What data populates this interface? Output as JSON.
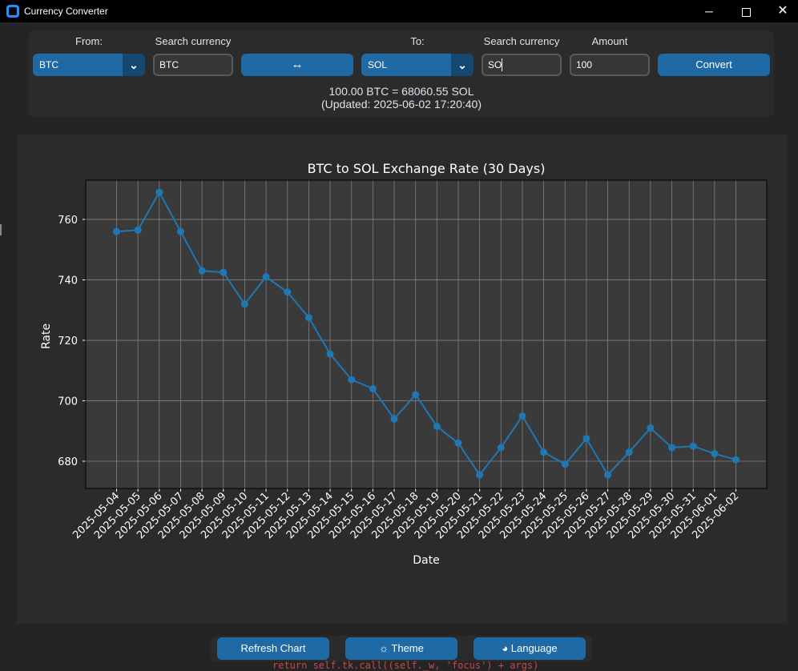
{
  "window": {
    "title": "Currency Converter",
    "minimize": "─",
    "close": "✕"
  },
  "converter": {
    "from_label": "From:",
    "from_value": "BTC",
    "from_search_label": "Search currency",
    "from_search_value": "BTC",
    "swap_label": "↔",
    "to_label": "To:",
    "to_value": "SOL",
    "to_search_label": "Search currency",
    "to_search_value": "SO",
    "amount_label": "Amount",
    "amount_value": "100",
    "convert_label": "Convert",
    "result_line": "100.00 BTC = 68060.55 SOL",
    "updated_line": "(Updated: 2025-06-02 17:20:40)",
    "dropdown_arrow": "⌄"
  },
  "chart_data": {
    "type": "line",
    "title": "BTC to SOL Exchange Rate (30 Days)",
    "xlabel": "Date",
    "ylabel": "Rate",
    "ylim": [
      671,
      773
    ],
    "yticks": [
      680,
      700,
      720,
      740,
      760
    ],
    "grid": true,
    "x": [
      "2025-05-04",
      "2025-05-05",
      "2025-05-06",
      "2025-05-07",
      "2025-05-08",
      "2025-05-09",
      "2025-05-10",
      "2025-05-11",
      "2025-05-12",
      "2025-05-13",
      "2025-05-14",
      "2025-05-15",
      "2025-05-16",
      "2025-05-17",
      "2025-05-18",
      "2025-05-19",
      "2025-05-20",
      "2025-05-21",
      "2025-05-22",
      "2025-05-23",
      "2025-05-24",
      "2025-05-25",
      "2025-05-26",
      "2025-05-27",
      "2025-05-28",
      "2025-05-29",
      "2025-05-30",
      "2025-05-31",
      "2025-06-01",
      "2025-06-02"
    ],
    "series": [
      {
        "values": [
          756.0,
          756.5,
          769.0,
          756.0,
          743.0,
          742.5,
          732.0,
          741.0,
          736.0,
          727.5,
          715.5,
          707.0,
          704.0,
          694.0,
          702.0,
          691.5,
          686.0,
          675.5,
          684.5,
          695.0,
          683.0,
          679.0,
          687.5,
          675.5,
          683.0,
          691.0,
          684.5,
          685.0,
          682.5,
          680.5
        ],
        "color": "#1f77b4"
      }
    ],
    "colors": {
      "plot_bg": "#3a3a3a",
      "grid": "#808080",
      "text": "#ffffff",
      "frame": "#000000"
    }
  },
  "bottom": {
    "refresh_label": "Refresh Chart",
    "theme_label": "☼ Theme",
    "language_label": "◕ Language",
    "console_text": "return self.tk.call((self._w, 'focus') + args)"
  },
  "colors": {
    "accent": "#1f6aa5",
    "accent_dark": "#144870",
    "panel": "#2b2b2b",
    "background": "#242424"
  }
}
